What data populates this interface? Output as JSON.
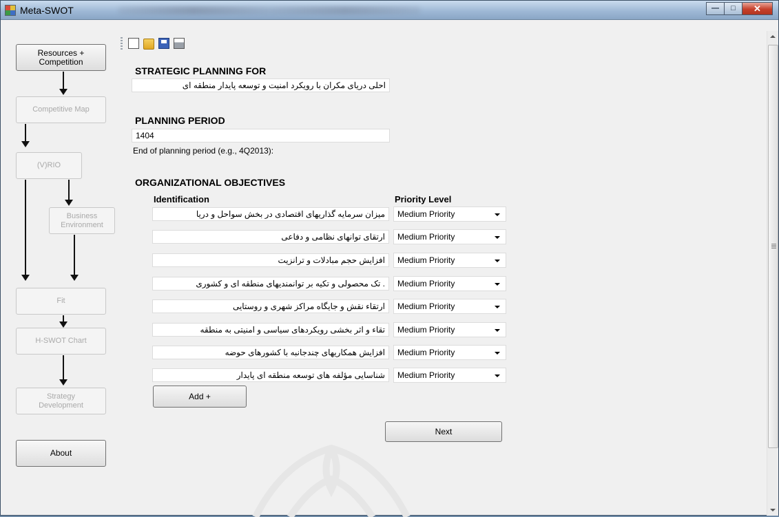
{
  "window": {
    "title": "Meta-SWOT"
  },
  "sidebar": {
    "items": [
      {
        "label": "Resources +\nCompetition",
        "enabled": true
      },
      {
        "label": "Competitive Map",
        "enabled": false
      },
      {
        "label": "(V)RIO",
        "enabled": false
      },
      {
        "label": "Business\nEnvironment",
        "enabled": false
      },
      {
        "label": "Fit",
        "enabled": false
      },
      {
        "label": "H-SWOT Chart",
        "enabled": false
      },
      {
        "label": "Strategy\nDevelopment",
        "enabled": false
      },
      {
        "label": "About",
        "enabled": true
      }
    ]
  },
  "toolbar": {
    "icons": [
      "new-document-icon",
      "open-folder-icon",
      "save-disk-icon",
      "print-icon"
    ]
  },
  "main": {
    "strategic_heading": "STRATEGIC PLANNING FOR",
    "strategic_value": "احلی دریای مکران با رویکرد امنیت و توسعه پایدار منطقه ای",
    "period_heading": "PLANNING PERIOD",
    "period_value": "1404",
    "period_hint": "End of planning period (e.g., 4Q2013):",
    "objectives_heading": "ORGANIZATIONAL OBJECTIVES",
    "col_identification": "Identification",
    "col_priority": "Priority Level",
    "objectives": [
      {
        "text": "میزان سرمایه گذاریهای اقتصادی در بخش سواحل و دریا",
        "priority": "Medium Priority"
      },
      {
        "text": "ارتقای توانهای نظامی و دفاعی",
        "priority": "Medium Priority"
      },
      {
        "text": "افزایش حجم مبادلات و ترانزیت",
        "priority": "Medium Priority"
      },
      {
        "text": ". تک محصولی و تکیه بر توانمندیهای منطقه ای و کشوری",
        "priority": "Medium Priority"
      },
      {
        "text": "ارتقاء نقش و جایگاه مراکز شهری و روستایی",
        "priority": "Medium Priority"
      },
      {
        "text": "تقاء و اثر بخشی رویکردهای سیاسی و امنیتی به منطقه",
        "priority": "Medium Priority"
      },
      {
        "text": "افزایش همکاریهای چندجانبه با کشورهای حوضه",
        "priority": "Medium Priority"
      },
      {
        "text": "شناسایی مؤلفه های توسعه منطقه ای پایدار",
        "priority": "Medium Priority"
      }
    ],
    "add_button": "Add +",
    "next_button": "Next"
  },
  "colors": {
    "accent": "#3b6ea5",
    "window_bg": "#f0f0f0",
    "close_button": "#c6402b"
  }
}
